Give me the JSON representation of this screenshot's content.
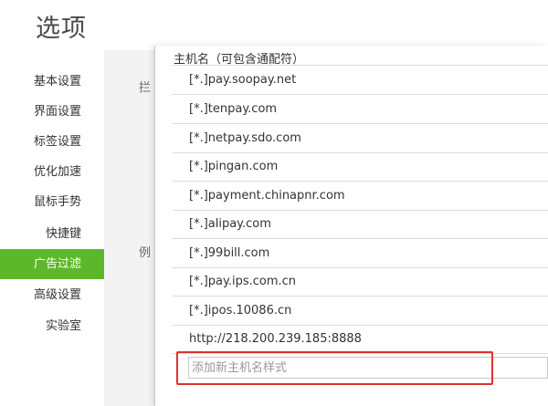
{
  "window": {
    "title": "选项"
  },
  "sidebar": {
    "items": [
      {
        "label": "基本设置",
        "active": false
      },
      {
        "label": "界面设置",
        "active": false
      },
      {
        "label": "标签设置",
        "active": false
      },
      {
        "label": "优化加速",
        "active": false
      },
      {
        "label": "鼠标手势",
        "active": false
      },
      {
        "label": "快捷键",
        "active": false
      },
      {
        "label": "广告过滤",
        "active": true
      },
      {
        "label": "高级设置",
        "active": false
      },
      {
        "label": "实验室",
        "active": false
      }
    ]
  },
  "background": {
    "label_1": "拦",
    "label_2": "例"
  },
  "dialog": {
    "list_header": "主机名（可包含通配符）",
    "hosts": [
      "[*.]pay.soopay.net",
      "[*.]tenpay.com",
      "[*.]netpay.sdo.com",
      "[*.]pingan.com",
      "[*.]payment.chinapnr.com",
      "[*.]alipay.com",
      "[*.]99bill.com",
      "[*.]pay.ips.com.cn",
      "[*.]ipos.10086.cn",
      "http://218.200.239.185:8888"
    ],
    "add_input": {
      "placeholder": "添加新主机名样式",
      "value": ""
    }
  },
  "colors": {
    "accent": "#5cb82a",
    "highlight_border": "#e0312f"
  }
}
